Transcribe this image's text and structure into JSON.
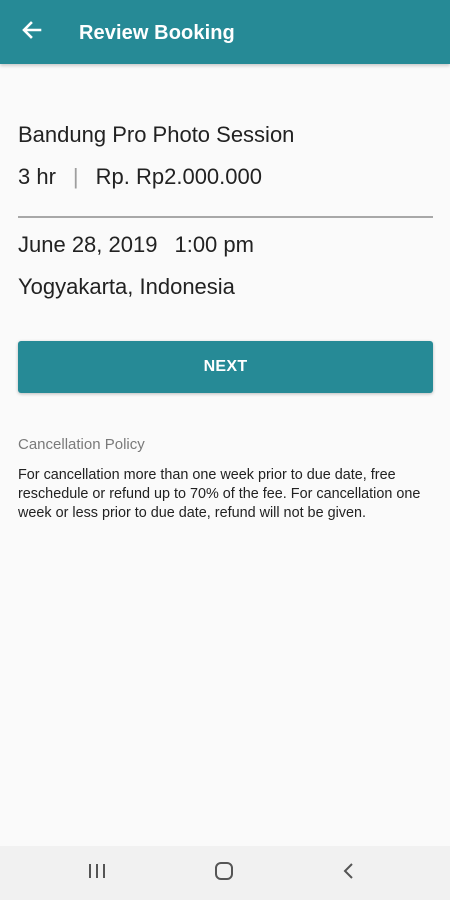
{
  "app_bar": {
    "title": "Review Booking",
    "back_icon": "arrow-left-icon",
    "background": "#268a96"
  },
  "booking": {
    "service_name": "Bandung Pro Photo Session",
    "duration": "3 hr",
    "separator": "|",
    "price": "Rp. Rp2.000.000",
    "date": "June 28,  2019",
    "time": "1:00 pm",
    "location": "Yogyakarta,  Indonesia"
  },
  "actions": {
    "next_label": "NEXT"
  },
  "policy": {
    "title": "Cancellation Policy",
    "text": "For cancellation more than one week prior to due date, free reschedule or refund up to 70% of the fee. For cancellation one week or less prior to due date, refund will not be given."
  },
  "system_nav": {
    "recents_icon": "recents-icon",
    "home_icon": "home-icon",
    "back_icon": "back-chevron-icon"
  },
  "colors": {
    "accent": "#268a96",
    "divider": "#a8a8a8",
    "background": "#fafafa"
  }
}
